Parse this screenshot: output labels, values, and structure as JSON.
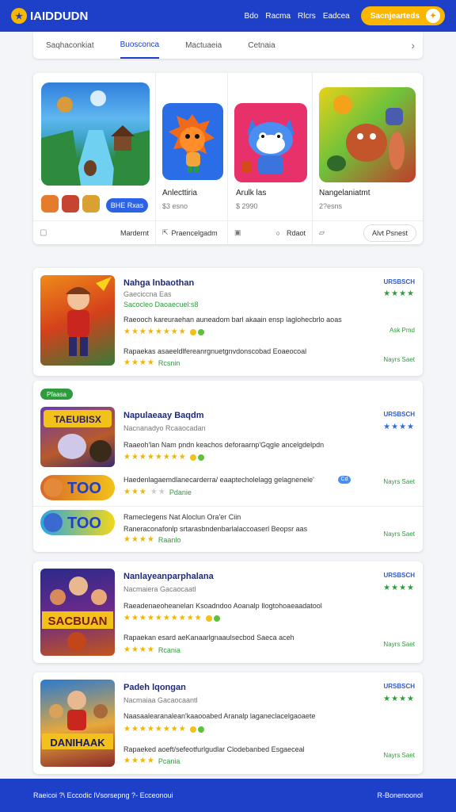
{
  "header": {
    "logo_mark": "★",
    "logo_text": "IAIDDUDN",
    "nav": [
      "Bdo",
      "Racma",
      "Rlcrs",
      "Eadcea"
    ],
    "cta_label": "Sacnjearteds",
    "cta_icon": "✦"
  },
  "tabs": {
    "items": [
      "Saqhaconkiat",
      "Buosconca",
      "Mactuaeia",
      "Cetnaia"
    ],
    "active": 1,
    "more_icon": "›"
  },
  "featured": {
    "hero": {
      "button": "BHE Rxas",
      "bar_label": "Mardernt"
    },
    "games": [
      {
        "name": "Anlecttiria",
        "sub": "$3 esno",
        "bar_label": "Praencelgadm"
      },
      {
        "name": "Arulk las",
        "sub": "$ 2990",
        "bar_label": "Rdaot"
      },
      {
        "name": "Nangelaniatmt",
        "sub": "2?esns",
        "bar_label": "Alvt Psnest"
      }
    ]
  },
  "games": [
    {
      "title": "Nahga lnbaothan",
      "sub": "Gaeciccna Eas",
      "sub2": "Sacocleo Daoaecuel:s8",
      "desc1": "Raeooch kareuraehan auneadom barl akaain ensp laglohecbrlo aoas",
      "desc2": "Rapaekas asaeeldlfereanrgnuetgnvdonscobad Eoaeocoal",
      "categories": "Rcsnin",
      "tag": "URSBSCH",
      "link": "Ask Pmd",
      "link2": "Nayrs Saet"
    },
    {
      "label": "Pfaasa",
      "title": "Napulaeaay Baqdm",
      "sub": "Nacnanadyo Rcaaocadan",
      "desc1": "Raaeoh'lan Nam pndn keachos deforaarnp'Gqgle ancelgdelpdn",
      "desc2": "Haedenlagaemdlanecarderra/ eaaptecholelagg gelagnenele'",
      "categories": "Pdanie",
      "desc3": "Rameclegens Nat Aloclun Ora'er Ciin",
      "desc4": "Raneraconafonlp srtarasbndenbarlalaccoaserl Beopsr aas",
      "categories2": "Raanlo",
      "tag": "URSBSCH",
      "badge": "Cd",
      "link": "Nayrs Saet",
      "link2": "Nayrs Saet",
      "link3": "Nayrs Saet"
    },
    {
      "title": "Nanlayeanparphalana",
      "sub": "Nacmaiera Gacaocaatl",
      "desc1": "Raeadenaeoheanelan Ksoadndoo Aoanalp Ilogtohoaeaadatool",
      "desc2": "Rapaekan esard aeKanaarlgnaaulsecbod Saeca aceh",
      "categories": "Rcania",
      "tag": "URSBSCH",
      "link": "Nayrs Saet"
    },
    {
      "title": "Padeh lqongan",
      "sub": "Nacmaiaa Gacaocaantl",
      "desc1": "Naasaalearanalean'kaaooabed Aranalp laganeclacelgaoaete",
      "desc2": "Rapaeked aoeft/sefeotfurlgudlar Clodebanbed Esgaeceal",
      "categories": "Pcania",
      "tag": "URSBSCH",
      "link": "Nayrs Saet"
    }
  ],
  "covers": {
    "c1_text": "",
    "c2_text": "TAEUBISX",
    "c3_text": "SACBUAN",
    "c4_text": "DANIHAAK"
  },
  "banners": [
    "TOO",
    "TOO"
  ],
  "footer": {
    "left": "Raeicoi ?\\ Eccodic lVsorsepng ?- Ecceonoui",
    "right": "R-Bonenoonol"
  },
  "colors": {
    "primary": "#1e40c8",
    "accent": "#fbb700",
    "green": "#2e9b3c"
  }
}
